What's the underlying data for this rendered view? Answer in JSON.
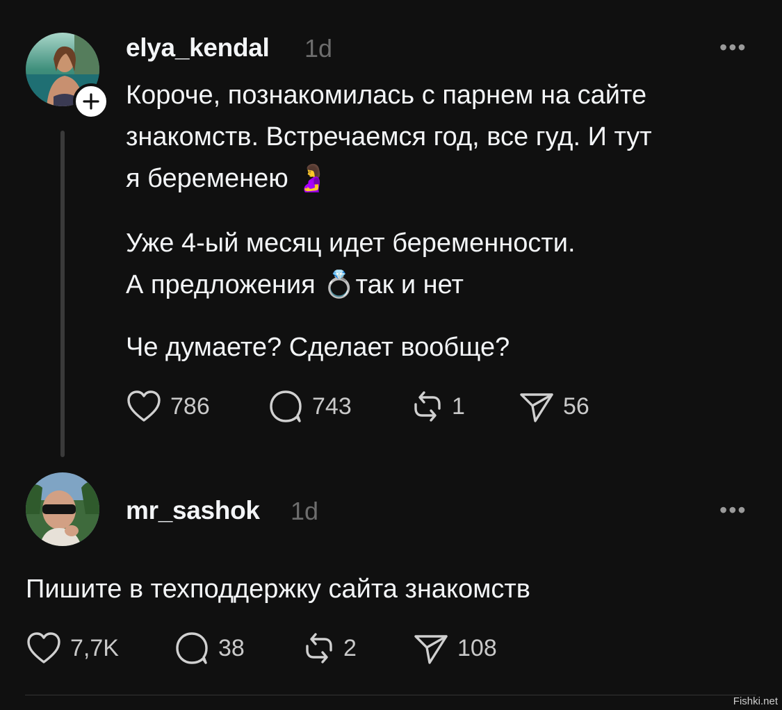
{
  "post": {
    "username": "elya_kendal",
    "time": "1d",
    "more_label": "•••",
    "lines": [
      "Короче, познакомилась с парнем на сайте",
      "знакомств. Встречаемся год, все гуд. И тут",
      "я беременею 🤰",
      "Уже 4-ый месяц идет беременности.",
      "А предложения 💍так и нет",
      "Че думаете? Сделает вообще?"
    ],
    "likes": "786",
    "comments": "743",
    "reposts": "1",
    "shares": "56"
  },
  "reply": {
    "username": "mr_sashok",
    "time": "1d",
    "more_label": "•••",
    "text": "Пишите в техподдержку сайта знакомств",
    "likes": "7,7K",
    "comments": "38",
    "reposts": "2",
    "shares": "108"
  },
  "watermark": "Fishki.net",
  "colors": {
    "background": "#101010",
    "text": "#f3f5f7",
    "muted": "#6d6d6d",
    "icon": "#d0d0d0"
  }
}
